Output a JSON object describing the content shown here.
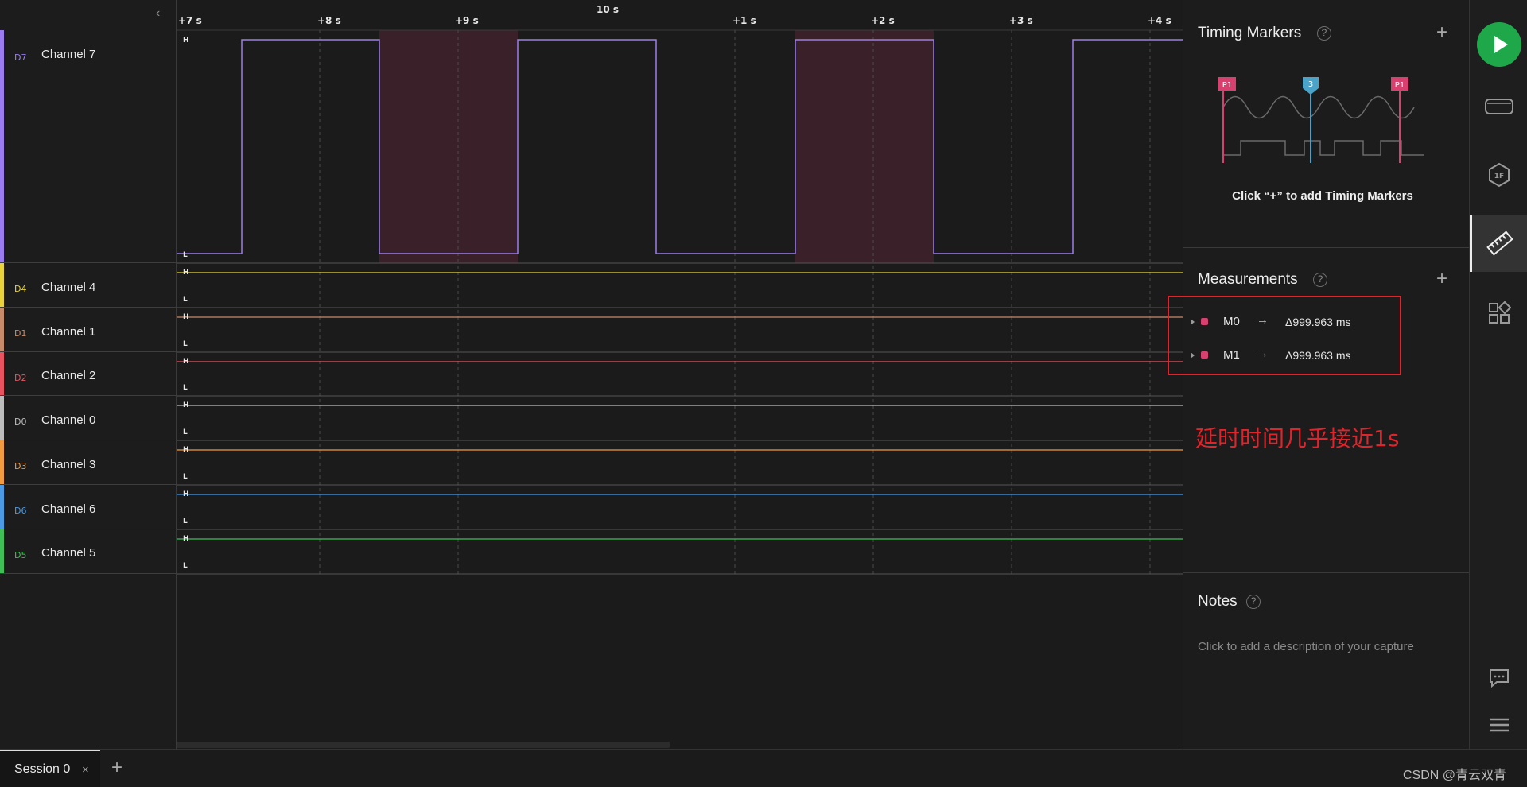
{
  "ruler": {
    "labels": [
      "+7 s",
      "+8 s",
      "+9 s",
      "10 s",
      "+1 s",
      "+2 s",
      "+3 s",
      "+4 s"
    ]
  },
  "level_labels": {
    "high": "H",
    "low": "L"
  },
  "channels": [
    {
      "id": "D7",
      "name": "Channel 7",
      "color": "#9b7cf0"
    },
    {
      "id": "D4",
      "name": "Channel 4",
      "color": "#e8d33a"
    },
    {
      "id": "D1",
      "name": "Channel 1",
      "color": "#c88b6a"
    },
    {
      "id": "D2",
      "name": "Channel 2",
      "color": "#e8535f"
    },
    {
      "id": "D0",
      "name": "Channel 0",
      "color": "#bdbdbd"
    },
    {
      "id": "D3",
      "name": "Channel 3",
      "color": "#f19a3e"
    },
    {
      "id": "D6",
      "name": "Channel 6",
      "color": "#4a9ae6"
    },
    {
      "id": "D5",
      "name": "Channel 5",
      "color": "#3fc057"
    }
  ],
  "timing_markers": {
    "title": "Timing Markers",
    "help": "?",
    "add": "+",
    "hint": "Click “+” to add Timing Markers",
    "illustration": {
      "left_flag": "P1",
      "middle_flag": "3",
      "right_flag": "P1"
    }
  },
  "measurements": {
    "title": "Measurements",
    "help": "?",
    "add": "+",
    "items": [
      {
        "name": "M0",
        "arrow": "→",
        "value": "Δ999.963 ms"
      },
      {
        "name": "M1",
        "arrow": "→",
        "value": "Δ999.963 ms"
      }
    ]
  },
  "notes": {
    "title": "Notes",
    "help": "?",
    "placeholder": "Click to add a description of your capture"
  },
  "annotation": {
    "text": "延时时间几乎接近1s"
  },
  "session": {
    "tab_label": "Session 0",
    "close": "×",
    "add": "+"
  },
  "watermark": "CSDN @青云双青",
  "colors": {
    "accent_green": "#1fa84a",
    "highlight_region": "#3a2129",
    "marker_pink": "#d8416f",
    "annotation_red": "#e0242c"
  },
  "sidebar_icons": [
    "play-icon",
    "device-icon",
    "analyzer-icon",
    "ruler-icon",
    "extensions-icon",
    "feedback-icon",
    "menu-icon"
  ]
}
